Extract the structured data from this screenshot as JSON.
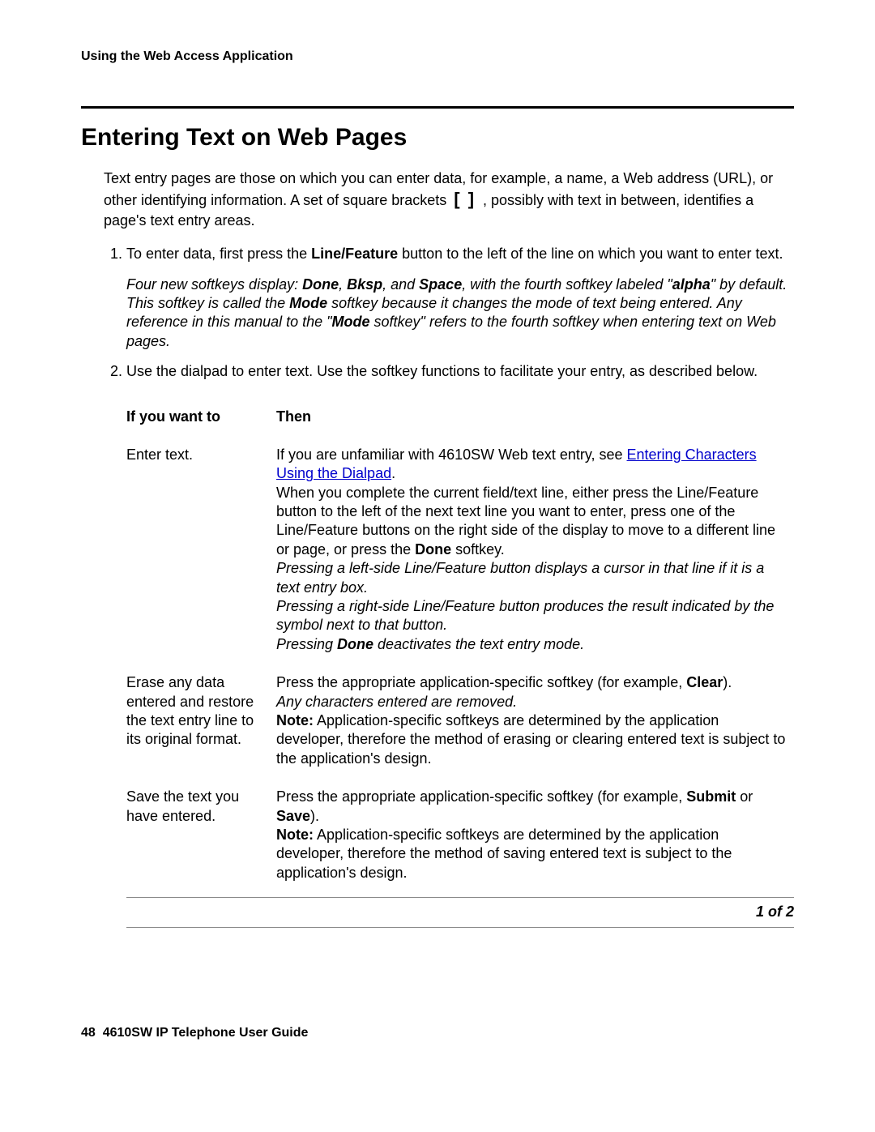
{
  "runningHead": "Using the Web Access Application",
  "heading": "Entering Text on Web Pages",
  "intro": {
    "part1": "Text entry pages are those on which you can enter data, for example, a name, a Web address (URL), or other identifying information. A set of square brackets ",
    "brackets": "[   ]",
    "part2": " , possibly with text in between, identifies a page's text entry areas."
  },
  "steps": {
    "s1a": "To enter data, first press the ",
    "s1b": "Line/Feature",
    "s1c": " button to the left of the line on which you want to enter text.",
    "note_a": "Four new softkeys display: ",
    "note_done": "Done",
    "note_comma1": ", ",
    "note_bksp": "Bksp",
    "note_comma2": ", and ",
    "note_space": "Space",
    "note_b": ", with the fourth softkey labeled \"",
    "note_alpha": "alpha",
    "note_c": "\" by default. This softkey is called the ",
    "note_mode1": "Mode",
    "note_d": " softkey because it changes the mode of text being entered. Any reference in this manual to the \"",
    "note_mode2": "Mode",
    "note_e": " softkey\" refers to the fourth softkey when entering text on Web pages.",
    "s2": "Use the dialpad to enter text. Use the softkey functions to facilitate your entry, as described below."
  },
  "table": {
    "h1": "If you want to",
    "h2": "Then",
    "rows": [
      {
        "left": "Enter text.",
        "r": {
          "p1": "If you are unfamiliar with 4610SW Web text entry, see ",
          "link": "Entering Characters Using the Dialpad",
          "p1b": ".",
          "p2a": "When you complete the current field/text line, either press the Line/Feature button to the left of the next text line you want to enter, press one of the Line/Feature buttons on the right side of the display to move to a different line or page, or press the ",
          "p2b": "Done",
          "p2c": " softkey.",
          "i1": "Pressing a left-side Line/Feature button displays a cursor in that line if it is a text entry box.",
          "i2": "Pressing a right-side Line/Feature button produces the result indicated by the symbol next to that button.",
          "i3a": "Pressing ",
          "i3b": "Done",
          "i3c": " deactivates the text entry mode."
        }
      },
      {
        "left": "Erase any data entered and restore the text entry line to its original format.",
        "r": {
          "p1a": "Press the appropriate application-specific softkey (for example, ",
          "p1b": "Clear",
          "p1c": ").",
          "i1": "Any characters entered are removed.",
          "n1a": "Note:",
          "n1b": " Application-specific softkeys are determined by the application developer, therefore the method of erasing or clearing entered text is subject to the application's design."
        }
      },
      {
        "left": "Save the text you have entered.",
        "r": {
          "p1a": "Press the appropriate application-specific softkey (for example, ",
          "p1b": "Submit",
          "p1c": " or ",
          "p1d": "Save",
          "p1e": ").",
          "n1a": "Note:",
          "n1b": " Application-specific softkeys are determined by the application developer, therefore the method of saving entered text is subject to the application's design."
        }
      }
    ],
    "footer": "1 of 2"
  },
  "footer": {
    "page": "48",
    "title": "4610SW IP Telephone User Guide"
  }
}
